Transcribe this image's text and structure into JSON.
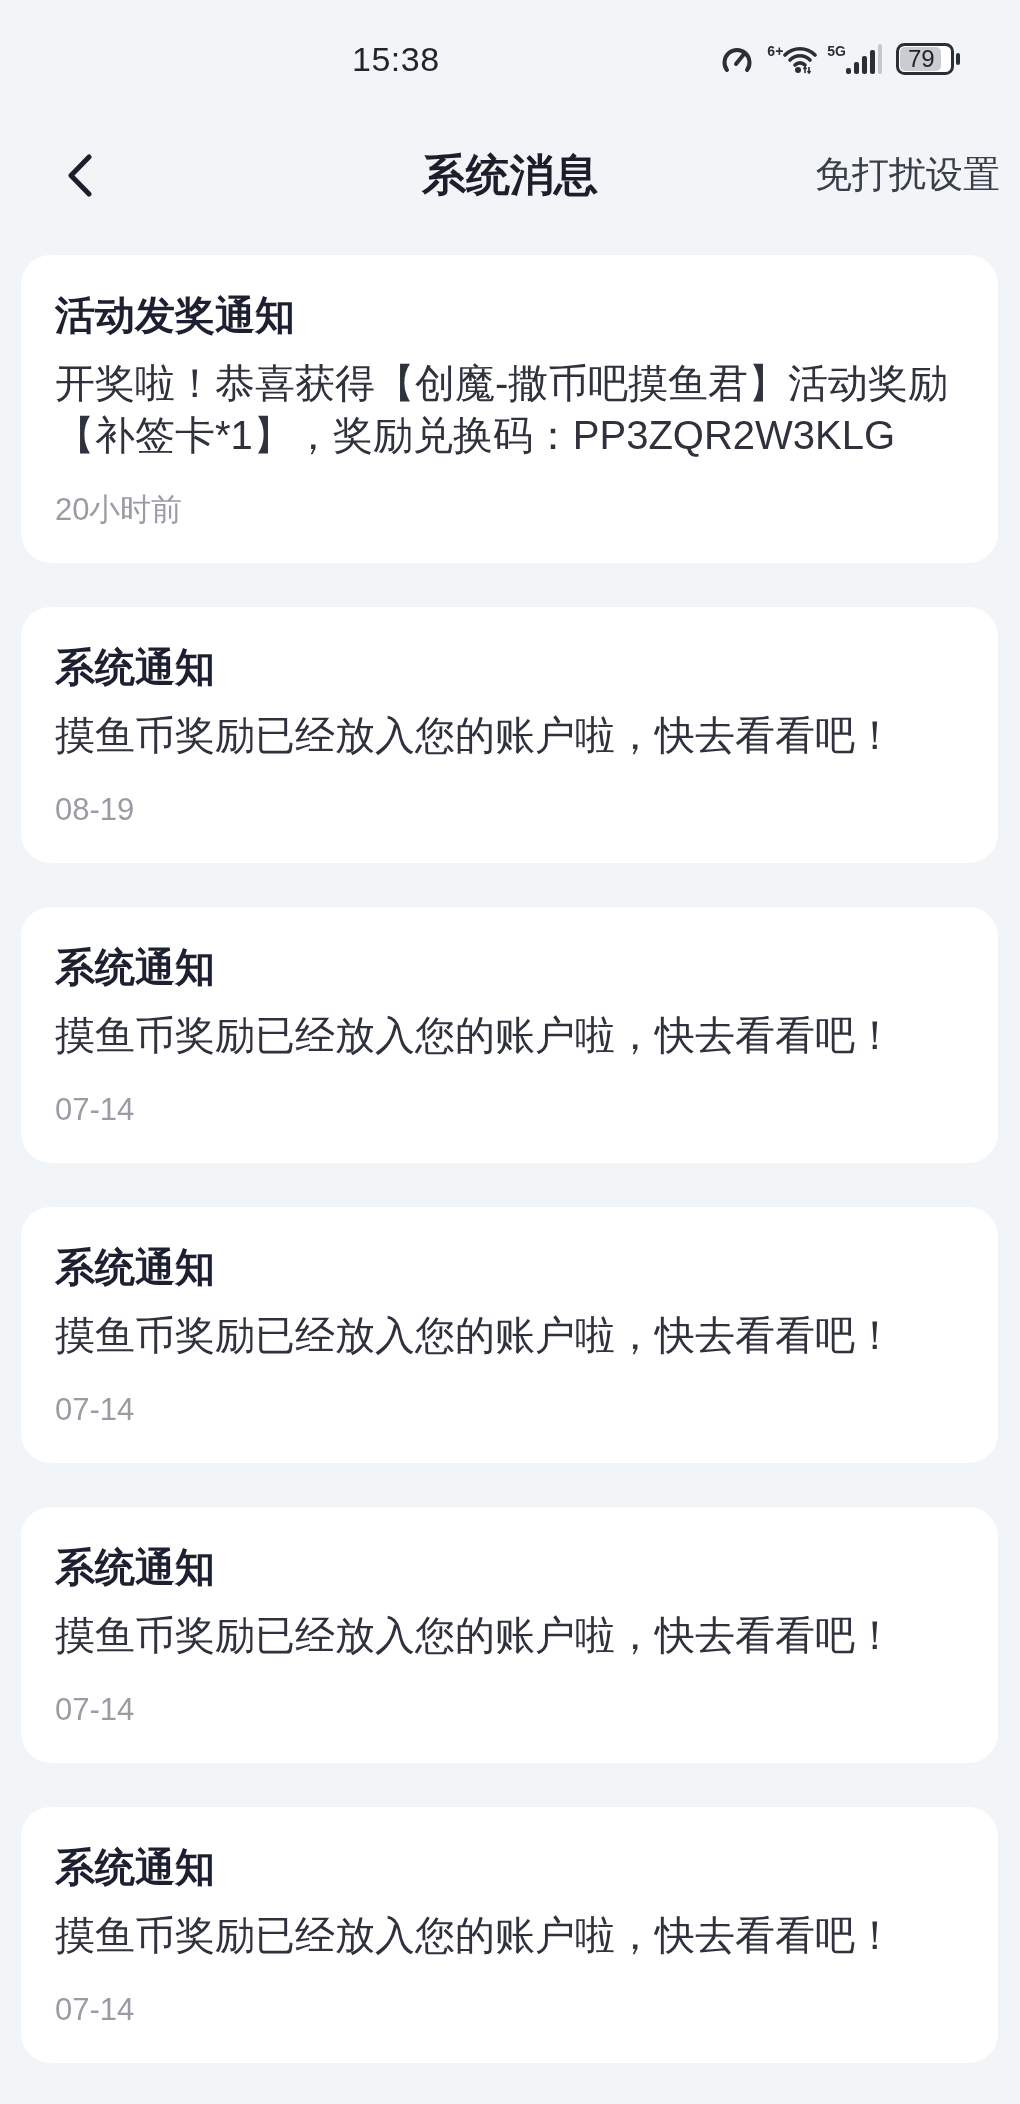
{
  "status_bar": {
    "time": "15:38",
    "wifi_label": "6+",
    "cellular_label": "5G",
    "battery": "79"
  },
  "header": {
    "title": "系统消息",
    "action": "免打扰设置"
  },
  "messages": [
    {
      "title": "活动发奖通知",
      "body": "开奖啦！恭喜获得【创魔-撒币吧摸鱼君】活动奖励【补签卡*1】，奖励兑换码：PP3ZQR2W3KLG",
      "time": "20小时前"
    },
    {
      "title": "系统通知",
      "body": "摸鱼币奖励已经放入您的账户啦，快去看看吧！",
      "time": "08-19"
    },
    {
      "title": "系统通知",
      "body": "摸鱼币奖励已经放入您的账户啦，快去看看吧！",
      "time": "07-14"
    },
    {
      "title": "系统通知",
      "body": "摸鱼币奖励已经放入您的账户啦，快去看看吧！",
      "time": "07-14"
    },
    {
      "title": "系统通知",
      "body": "摸鱼币奖励已经放入您的账户啦，快去看看吧！",
      "time": "07-14"
    },
    {
      "title": "系统通知",
      "body": "摸鱼币奖励已经放入您的账户啦，快去看看吧！",
      "time": "07-14"
    }
  ]
}
